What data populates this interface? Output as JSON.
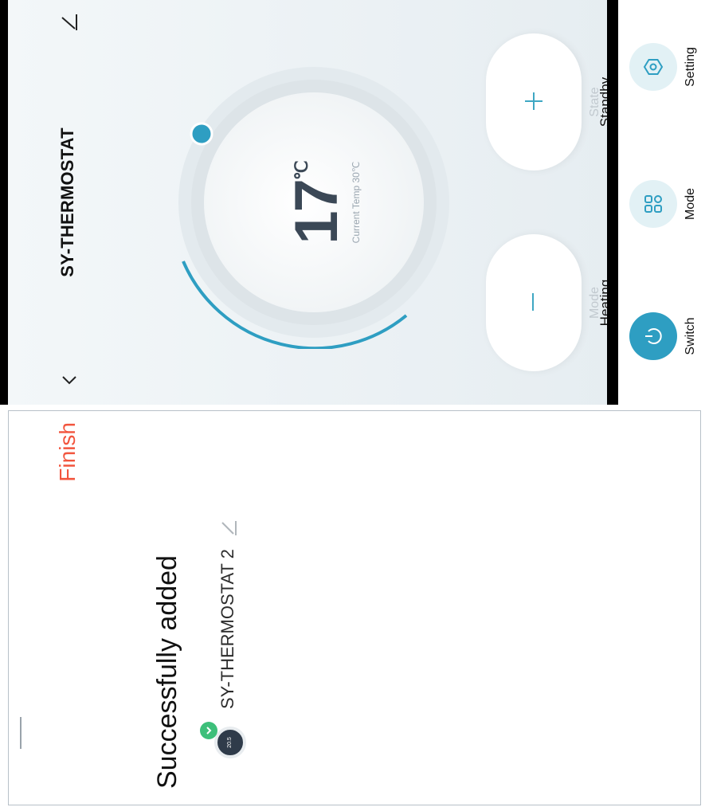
{
  "thermostat": {
    "title": "SY-THERMOSTAT",
    "setpoint": "17",
    "unit": "℃",
    "current_temp": "Current Temp 30℃",
    "mode_label": "Mode",
    "mode_value": "Heating",
    "state_label": "State",
    "state_value": "Standby",
    "bottom_switch": "Switch",
    "bottom_mode": "Mode",
    "bottom_setting": "Setting"
  },
  "added": {
    "finish": "Finish",
    "title": "Successfully added",
    "device_name": "SY-THERMOSTAT 2",
    "device_icon_text": "20.5"
  },
  "colors": {
    "accent": "#2e9ec2",
    "finish": "#f2553e",
    "success": "#3dbf7a"
  }
}
